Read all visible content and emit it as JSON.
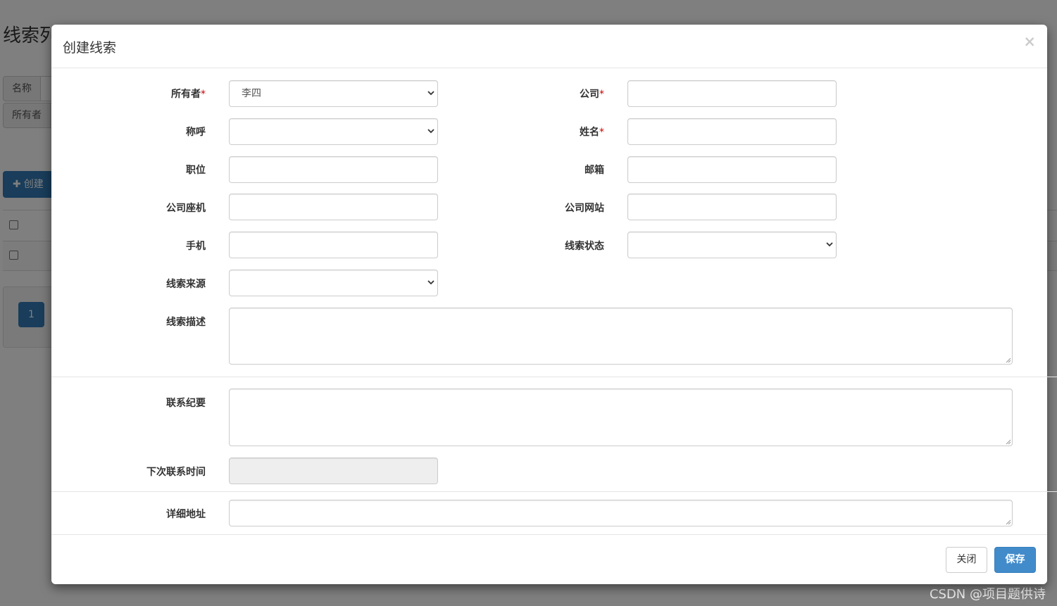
{
  "background": {
    "page_title": "线索列",
    "search_rows": [
      {
        "label": "名称"
      },
      {
        "label": "所有者"
      }
    ],
    "create_button": "创建",
    "pager_current": "1"
  },
  "modal": {
    "title": "创建线索",
    "close_symbol": "×",
    "required_mark": "*",
    "fields": {
      "owner": {
        "label": "所有者",
        "value": "李四"
      },
      "company": {
        "label": "公司",
        "value": ""
      },
      "appellation": {
        "label": "称呼",
        "value": ""
      },
      "fullname": {
        "label": "姓名",
        "value": ""
      },
      "job": {
        "label": "职位",
        "value": ""
      },
      "email": {
        "label": "邮箱",
        "value": ""
      },
      "phone": {
        "label": "公司座机",
        "value": ""
      },
      "website": {
        "label": "公司网站",
        "value": ""
      },
      "mphone": {
        "label": "手机",
        "value": ""
      },
      "state": {
        "label": "线索状态",
        "value": ""
      },
      "source": {
        "label": "线索来源",
        "value": ""
      },
      "description": {
        "label": "线索描述",
        "value": ""
      },
      "contact_summary": {
        "label": "联系纪要",
        "value": ""
      },
      "next_contact_time": {
        "label": "下次联系时间",
        "value": ""
      },
      "address": {
        "label": "详细地址",
        "value": ""
      }
    },
    "footer": {
      "close_button": "关闭",
      "save_button": "保存"
    }
  },
  "watermark": "CSDN @项目题供诗",
  "colors": {
    "primary": "#428bca",
    "required": "#cc0000",
    "backdrop": "rgba(0,0,0,0.5)"
  }
}
